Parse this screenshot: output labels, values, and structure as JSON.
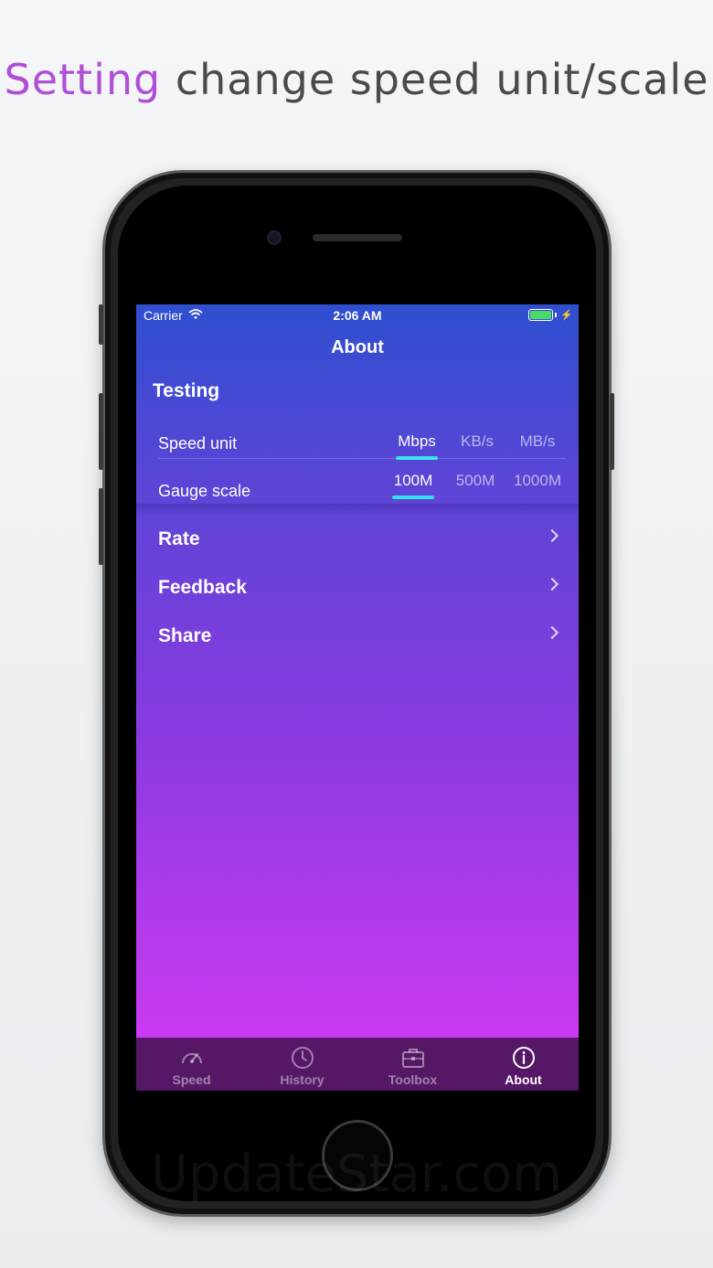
{
  "headline": {
    "accent": "Setting",
    "rest": "change speed unit/scale"
  },
  "status_bar": {
    "carrier": "Carrier",
    "time": "2:06 AM"
  },
  "nav": {
    "title": "About"
  },
  "testing": {
    "section_title": "Testing",
    "speed_unit": {
      "label": "Speed unit",
      "options": [
        "Mbps",
        "KB/s",
        "MB/s"
      ],
      "selected": "Mbps"
    },
    "gauge_scale": {
      "label": "Gauge scale",
      "options": [
        "100M",
        "500M",
        "1000M"
      ],
      "selected": "100M"
    }
  },
  "menu": [
    {
      "label": "Rate"
    },
    {
      "label": "Feedback"
    },
    {
      "label": "Share"
    }
  ],
  "tabs": [
    {
      "label": "Speed",
      "icon": "gauge-icon"
    },
    {
      "label": "History",
      "icon": "clock-icon"
    },
    {
      "label": "Toolbox",
      "icon": "briefcase-icon"
    },
    {
      "label": "About",
      "icon": "info-icon",
      "active": true
    }
  ],
  "watermark": "UpdateStar.com",
  "colors": {
    "accent": "#b04fd6",
    "selection_underline": "#33e0ee",
    "tab_bar": "#561866",
    "battery": "#4cd964"
  }
}
